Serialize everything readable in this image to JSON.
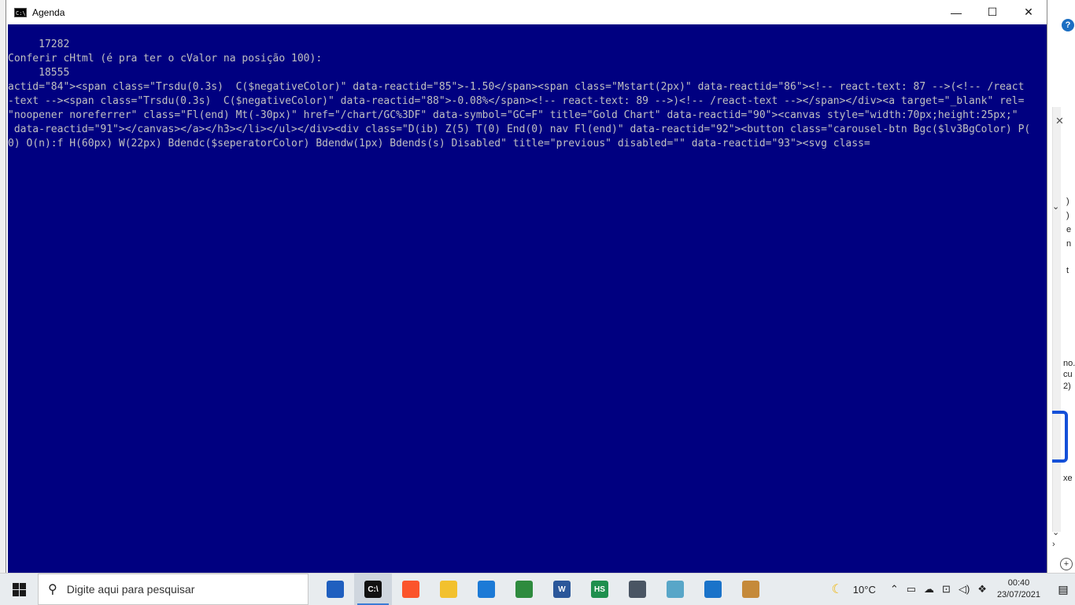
{
  "window": {
    "title": "Agenda",
    "minimize_glyph": "—",
    "maximize_glyph": "☐",
    "close_glyph": "✕",
    "icon": "console-icon"
  },
  "console": {
    "background": "#000080",
    "foreground": "#c0c0c0",
    "lines": [
      "     17282",
      "Conferir cHtml (é pra ter o cValor na posição 100):",
      "     18555",
      "actid=\"84\"><span class=\"Trsdu(0.3s)  C($negativeColor)\" data-reactid=\"85\">-1.50</span><span class=\"Mstart(2px)\" data-reactid=\"86\"><!-- react-text: 87 -->(<!-- /react",
      "-text --><span class=\"Trsdu(0.3s)  C($negativeColor)\" data-reactid=\"88\">-0.08%</span><!-- react-text: 89 -->)<!-- /react-text --></span></div><a target=\"_blank\" rel=",
      "\"noopener noreferrer\" class=\"Fl(end) Mt(-30px)\" href=\"/chart/GC%3DF\" data-symbol=\"GC=F\" title=\"Gold Chart\" data-reactid=\"90\"><canvas style=\"width:70px;height:25px;\"",
      " data-reactid=\"91\"></canvas></a></h3></li></ul></div><div class=\"D(ib) Z(5) T(0) End(0) nav Fl(end)\" data-reactid=\"92\"><button class=\"carousel-btn Bgc($lv3BgColor) P(",
      "0) O(n):f H(60px) W(22px) Bdendc($seperatorColor) Bdendw(1px) Bdends(s) Disabled\" title=\"previous\" disabled=\"\" data-reactid=\"93\"><svg class="
    ]
  },
  "background_app": {
    "help_label": "?",
    "fragments": [
      ")",
      ")",
      "e",
      "n",
      "t",
      "no.",
      "cu",
      "2)",
      "xe"
    ]
  },
  "taskbar": {
    "search_placeholder": "Digite aqui para pesquisar",
    "apps": [
      {
        "name": "azure-app-icon",
        "label": "",
        "color": "#1f5fbf",
        "active": false
      },
      {
        "name": "console-app-icon",
        "label": "C:\\",
        "color": "#111111",
        "active": true
      },
      {
        "name": "brave-browser-icon",
        "label": "",
        "color": "#fb542b",
        "active": false
      },
      {
        "name": "file-explorer-icon",
        "label": "",
        "color": "#f2c12e",
        "active": false
      },
      {
        "name": "edge-icon",
        "label": "",
        "color": "#1c7ad6",
        "active": false
      },
      {
        "name": "notepad-chart-icon",
        "label": "",
        "color": "#2e8b3e",
        "active": false
      },
      {
        "name": "word-icon",
        "label": "W",
        "color": "#2b579a",
        "active": false
      },
      {
        "name": "hs-app-icon",
        "label": "HS",
        "color": "#1f8f4e",
        "active": false
      },
      {
        "name": "calculator-icon",
        "label": "",
        "color": "#4a5563",
        "active": false
      },
      {
        "name": "notebook-icon",
        "label": "",
        "color": "#58a6c8",
        "active": false
      },
      {
        "name": "photos-icon",
        "label": "",
        "color": "#1a73c9",
        "active": false
      },
      {
        "name": "paint-icon",
        "label": "",
        "color": "#c58a3a",
        "active": false
      }
    ],
    "tray": {
      "temperature": "10°C",
      "time": "00:40",
      "date": "23/07/2021"
    }
  }
}
